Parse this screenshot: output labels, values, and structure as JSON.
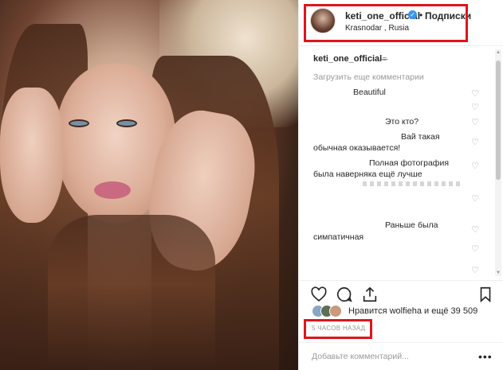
{
  "post": {
    "username": "keti_one_official",
    "follow_label": "Подписки",
    "separator": "•",
    "location": "Krasnodar , Rusia",
    "caption_user": "keti_one_official",
    "caption_symbol": "⌯",
    "load_more": "Загрузить еще комментарии",
    "comments": [
      {
        "text": "Beautiful"
      },
      {
        "text": "Это кто?"
      },
      {
        "text": "Вай такая"
      },
      {
        "text": "обычная оказывается!"
      },
      {
        "text": "Полная фотография"
      },
      {
        "text": "была наверняка ещё лучше"
      },
      {
        "text": "Раньше была"
      },
      {
        "text": "симпатичная"
      }
    ],
    "likes_text": "Нравится wolfieha и ещё 39 509",
    "time": "5 ЧАСОВ НАЗАД",
    "add_comment_placeholder": "Добавьте комментарий...",
    "more_label": "•••"
  },
  "icons": {
    "verified": "verified-badge-icon",
    "like": "heart-icon",
    "comment": "comment-bubble-icon",
    "share": "share-icon",
    "save": "bookmark-icon"
  },
  "colors": {
    "highlight": "#e0141c",
    "verified": "#3897f0",
    "muted": "#999999",
    "text": "#262626"
  }
}
